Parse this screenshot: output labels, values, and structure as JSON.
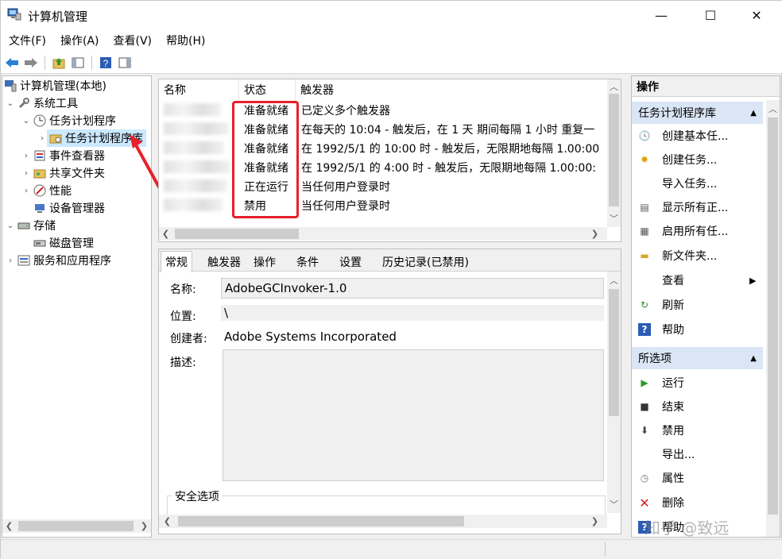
{
  "window": {
    "title": "计算机管理"
  },
  "controls": {
    "minimize": "—",
    "maximize": "☐",
    "close": "✕"
  },
  "menu": [
    "文件(F)",
    "操作(A)",
    "查看(V)",
    "帮助(H)"
  ],
  "tree": {
    "root": "计算机管理(本地)",
    "system_tools": "系统工具",
    "task_scheduler": "任务计划程序",
    "task_library": "任务计划程序库",
    "event_viewer": "事件查看器",
    "shared_folders": "共享文件夹",
    "performance": "性能",
    "device_manager": "设备管理器",
    "storage": "存储",
    "disk_management": "磁盘管理",
    "services": "服务和应用程序"
  },
  "task_list": {
    "columns": [
      "名称",
      "状态",
      "触发器"
    ],
    "rows": [
      {
        "status": "准备就绪",
        "trigger": "已定义多个触发器"
      },
      {
        "status": "准备就绪",
        "trigger": "在每天的 10:04 - 触发后，在 1 天 期间每隔 1 小时 重复一"
      },
      {
        "status": "准备就绪",
        "trigger": "在 1992/5/1 的 10:00 时 - 触发后，无限期地每隔 1.00:00"
      },
      {
        "status": "准备就绪",
        "trigger": "在 1992/5/1 的 4:00 时 - 触发后，无限期地每隔 1.00:00:"
      },
      {
        "status": "正在运行",
        "trigger": "当任何用户登录时"
      },
      {
        "status": "禁用",
        "trigger": "当任何用户登录时"
      }
    ]
  },
  "detail": {
    "tabs": [
      "常规",
      "触发器",
      "操作",
      "条件",
      "设置",
      "历史记录(已禁用)"
    ],
    "name_label": "名称:",
    "name_value": "AdobeGCInvoker-1.0",
    "location_label": "位置:",
    "location_value": "\\",
    "author_label": "创建者:",
    "author_value": "Adobe Systems Incorporated",
    "desc_label": "描述:",
    "security_label": "安全选项"
  },
  "actions": {
    "header": "操作",
    "section1": "任务计划程序库",
    "items1": [
      "创建基本任...",
      "创建任务...",
      "导入任务...",
      "显示所有正...",
      "启用所有任...",
      "新文件夹...",
      "查看",
      "刷新",
      "帮助"
    ],
    "section2": "所选项",
    "items2": [
      "运行",
      "结束",
      "禁用",
      "导出...",
      "属性",
      "删除",
      "帮助"
    ]
  },
  "watermark": "知乎 @致远",
  "colors": {
    "highlight_box": "#e8202a",
    "section_bg": "#dae6f5",
    "selection": "#cce8ff"
  }
}
